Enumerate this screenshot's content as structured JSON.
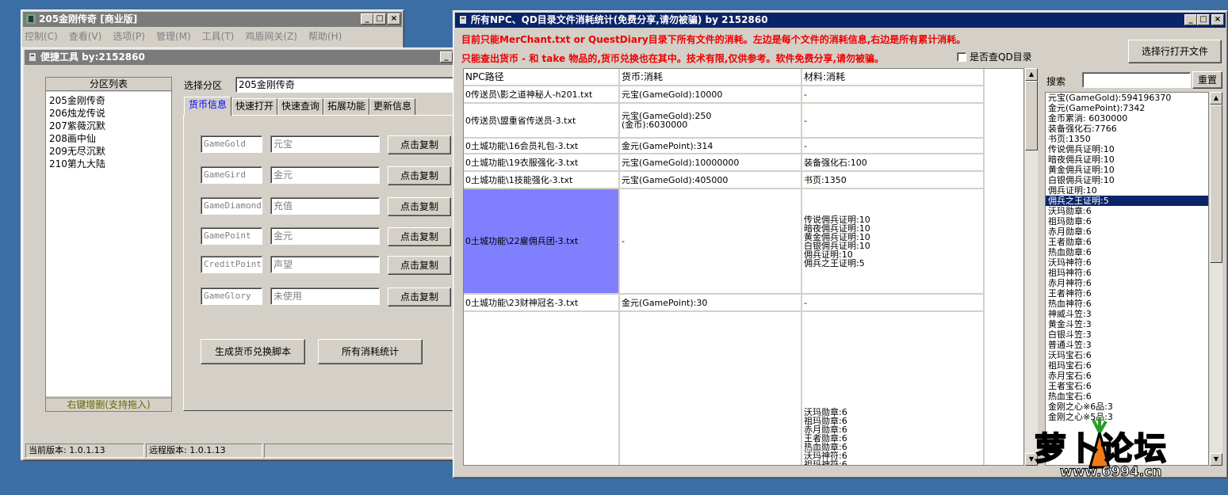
{
  "main_window": {
    "title": "205金刚传奇 [商业版]",
    "menu": [
      "控制(C)",
      "查看(V)",
      "选项(P)",
      "管理(M)",
      "工具(T)",
      "鸡盾网关(Z)",
      "帮助(H)"
    ]
  },
  "tool_window": {
    "title": "便捷工具  by:2152860",
    "partition_list_title": "分区列表",
    "partitions": [
      "205金刚传奇",
      "206烛龙传说",
      "207紫薇沉默",
      "208画中仙",
      "209无尽沉默",
      "210第九大陆"
    ],
    "partition_footer": "右键增删(支持拖入)",
    "select_label": "选择分区",
    "select_value": "205金刚传奇",
    "tabs": [
      "货币信息",
      "快速打开",
      "快速查询",
      "拓展功能",
      "更新信息"
    ],
    "currency_rows": [
      {
        "code": "GameGold",
        "name": "元宝",
        "button": "点击复制"
      },
      {
        "code": "GameGird",
        "name": "金元",
        "button": "点击复制"
      },
      {
        "code": "GameDiamond",
        "name": "充值",
        "button": "点击复制"
      },
      {
        "code": "GamePoint",
        "name": "金元",
        "button": "点击复制"
      },
      {
        "code": "CreditPoint",
        "name": "声望",
        "button": "点击复制"
      },
      {
        "code": "GameGlory",
        "name": "未使用",
        "button": "点击复制"
      }
    ],
    "gen_button": "生成货币兑换脚本",
    "stats_button": "所有消耗统计",
    "status_local": "当前版本: 1.0.1.13",
    "status_remote": "远程版本: 1.0.1.13"
  },
  "stats_window": {
    "title": "所有NPC、QD目录文件消耗统计(免费分享,请勿被骗)    by 2152860",
    "note1": "目前只能MerChant.txt or QuestDiary目录下所有文件的消耗。左边是每个文件的消耗信息,右边是所有累计消耗。",
    "note2": "只能查出货币 - 和 take 物品的,货币兑换也在其中。技术有限,仅供参考。软件免费分享,请勿被骗。",
    "checkbox_label": "是否查QD目录",
    "open_button": "选择行打开文件",
    "search_label": "搜索",
    "search_value": "",
    "reset_button": "重置",
    "columns": [
      "NPC路径",
      "货币:消耗",
      "材料:消耗"
    ],
    "rows": [
      {
        "path": "0传送员\\影之道神秘人-h201.txt",
        "currency": "元宝(GameGold):10000",
        "material": "-"
      },
      {
        "path": "0传送员\\盟重省传送员-3.txt",
        "currency": "元宝(GameGold):250\n(金币):6030000",
        "material": "-"
      },
      {
        "path": "0土城功能\\16会员礼包-3.txt",
        "currency": "金元(GamePoint):314",
        "material": "-"
      },
      {
        "path": "0土城功能\\19衣服强化-3.txt",
        "currency": "元宝(GameGold):10000000",
        "material": "装备强化石:100"
      },
      {
        "path": "0土城功能\\1技能强化-3.txt",
        "currency": "元宝(GameGold):405000",
        "material": "书页:1350"
      },
      {
        "path": "0土城功能\\22雇佣兵团-3.txt",
        "currency": "-",
        "material": "传说佣兵证明:10\n暗夜佣兵证明:10\n黄金佣兵证明:10\n白银佣兵证明:10\n佣兵证明:10\n佣兵之王证明:5"
      },
      {
        "path": "0土城功能\\23财神冠名-3.txt",
        "currency": "金元(GamePoint):30",
        "material": "-"
      },
      {
        "path": "",
        "currency": "",
        "material": "沃玛勋章:6\n祖玛勋章:6\n赤月勋章:6\n王者勋章:6\n热血勋章:6\n沃玛神符:6\n祖玛神符:6"
      }
    ],
    "totals": [
      "元宝(GameGold):594196370",
      "金元(GamePoint):7342",
      "金币累消: 6030000",
      "装备强化石:7766",
      "书页:1350",
      "传说佣兵证明:10",
      "暗夜佣兵证明:10",
      "黄金佣兵证明:10",
      "白银佣兵证明:10",
      "佣兵证明:10",
      "佣兵之王证明:5",
      "沃玛勋章:6",
      "祖玛勋章:6",
      "赤月勋章:6",
      "王者勋章:6",
      "热血勋章:6",
      "沃玛神符:6",
      "祖玛神符:6",
      "赤月神符:6",
      "王者神符:6",
      "热血神符:6",
      "神威斗笠:3",
      "黄金斗笠:3",
      "白银斗笠:3",
      "普通斗笠:3",
      "沃玛宝石:6",
      "祖玛宝石:6",
      "赤月宝石:6",
      "王者宝石:6",
      "热血宝石:6",
      "金刚之心※6品:3",
      "金刚之心※5品:3"
    ],
    "selected_total_index": 10
  },
  "watermark": {
    "logo": "萝卜论坛",
    "url": "www.6994.cn"
  }
}
